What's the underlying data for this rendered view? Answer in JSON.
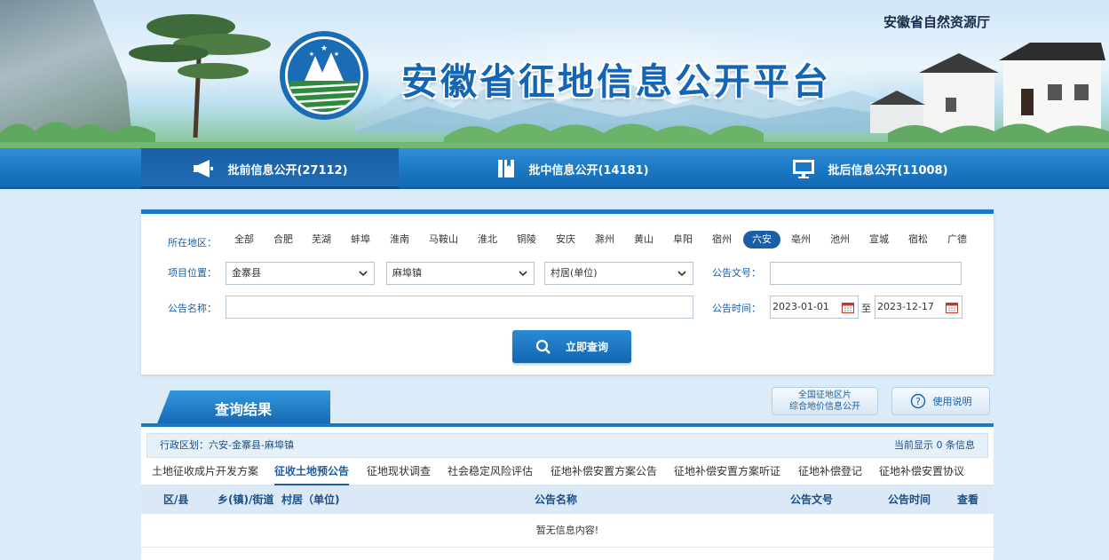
{
  "header": {
    "department": "安徽省自然资源厅",
    "title": "安徽省征地信息公开平台"
  },
  "nav": {
    "items": [
      {
        "label": "批前信息公开(27112)",
        "icon": "megaphone-icon",
        "active": true
      },
      {
        "label": "批中信息公开(14181)",
        "icon": "book-icon",
        "active": false
      },
      {
        "label": "批后信息公开(11008)",
        "icon": "monitor-icon",
        "active": false
      }
    ]
  },
  "search": {
    "region_label": "所在地区：",
    "regions": [
      "全部",
      "合肥",
      "芜湖",
      "蚌埠",
      "淮南",
      "马鞍山",
      "淮北",
      "铜陵",
      "安庆",
      "滁州",
      "黄山",
      "阜阳",
      "宿州",
      "六安",
      "亳州",
      "池州",
      "宣城",
      "宿松",
      "广德"
    ],
    "active_region": "六安",
    "location_label": "项目位置：",
    "county_value": "金寨县",
    "town_value": "麻埠镇",
    "village_value": "村居(单位)",
    "doc_no_label": "公告文号：",
    "doc_no_value": "",
    "name_label": "公告名称：",
    "name_value": "",
    "time_label": "公告时间：",
    "date_from": "2023-01-01",
    "date_sep": "至",
    "date_to": "2023-12-17",
    "button": "立即查询"
  },
  "results": {
    "tab_title": "查询结果",
    "side_button_1_line1": "全国征地区片",
    "side_button_1_line2": "综合地价信息公开",
    "side_button_2": "使用说明",
    "admin_region": "行政区划：六安-金寨县-麻埠镇",
    "count_text": "当前显示 0 条信息",
    "tabs": [
      "土地征收成片开发方案",
      "征收土地预公告",
      "征地现状调查",
      "社会稳定风险评估",
      "征地补偿安置方案公告",
      "征地补偿安置方案听证",
      "征地补偿登记",
      "征地补偿安置协议"
    ],
    "active_tab": "征收土地预公告",
    "columns": [
      "区/县",
      "乡(镇)/街道",
      "村居（单位)",
      "公告名称",
      "公告文号",
      "公告时间",
      "查看"
    ],
    "empty_text": "暂无信息内容!"
  },
  "colors": {
    "primary": "#1b78c4",
    "dark": "#1a5ea6",
    "page_bg": "#dcebf8"
  }
}
